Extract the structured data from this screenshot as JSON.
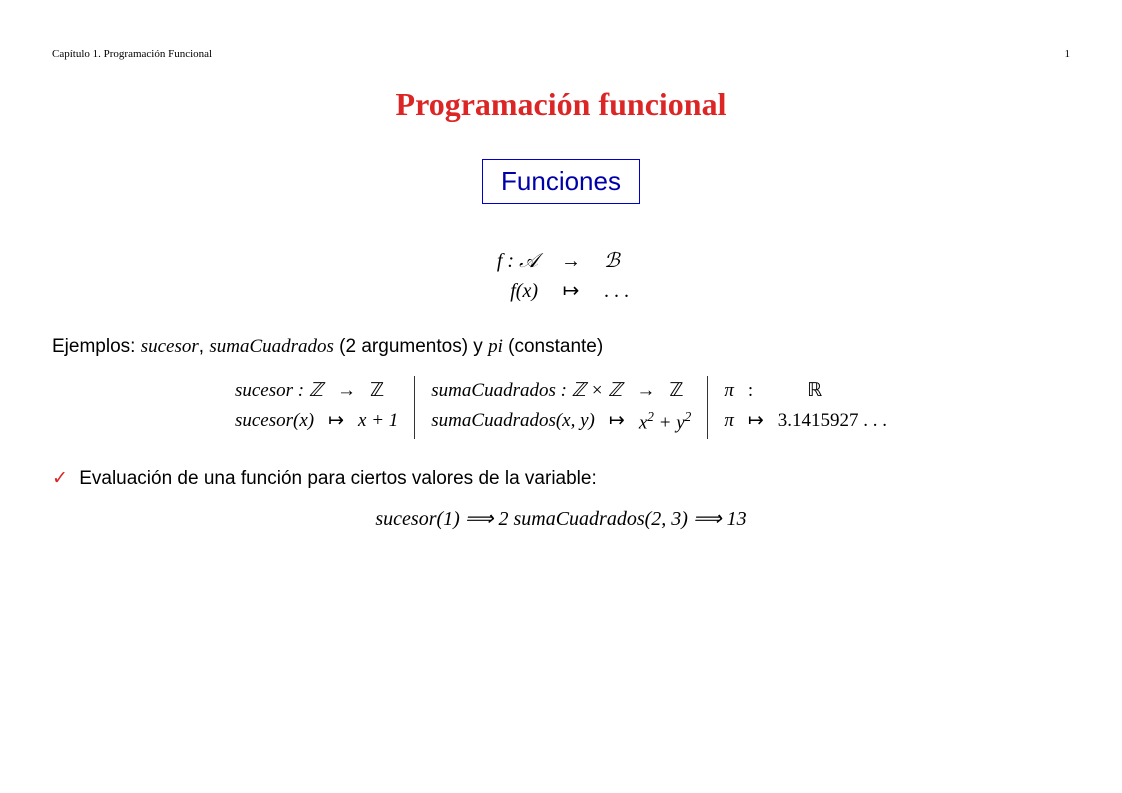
{
  "header": {
    "left": "Capítulo 1. Programación Funcional",
    "page": "1"
  },
  "title": "Programación funcional",
  "section": "Funciones",
  "fnDef": {
    "row1": {
      "l": "f : 𝒜",
      "m": "→",
      "r": "ℬ"
    },
    "row2": {
      "l": "f(x)",
      "m": "↦",
      "r": ". . ."
    }
  },
  "examplesIntro": {
    "prefix": "Ejemplos: ",
    "ex1": "sucesor",
    "sep1": ", ",
    "ex2": "sumaCuadrados",
    "note2": " (2 argumentos) y ",
    "ex3": "pi",
    "note3": " (constante)"
  },
  "examples": {
    "sucesor": {
      "r1": {
        "c1": "sucesor : ℤ",
        "c2": "→",
        "c3": "ℤ"
      },
      "r2": {
        "c1": "sucesor(x)",
        "c2": "↦",
        "c3": "x + 1"
      }
    },
    "sumaCuadrados": {
      "r1": {
        "c1": "sumaCuadrados : ℤ × ℤ",
        "c2": "→",
        "c3": "ℤ"
      },
      "r2": {
        "c1": "sumaCuadrados(x, y)",
        "c2": "↦",
        "c3_prefix": "x",
        "c3_sup1": "2",
        "c3_mid": " + y",
        "c3_sup2": "2"
      }
    },
    "pi": {
      "r1": {
        "c1": "π",
        "c2": ":",
        "c3": "ℝ"
      },
      "r2": {
        "c1": "π",
        "c2": "↦",
        "c3": "3.1415927 . . ."
      }
    }
  },
  "evalLine": {
    "check": "✓",
    "text": "Evaluación de una función para ciertos valores de la variable:"
  },
  "evalExpr": {
    "e1": "sucesor(1) ⟹ 2",
    "gap": "  ",
    "e2": "sumaCuadrados(2, 3) ⟹ 13"
  }
}
